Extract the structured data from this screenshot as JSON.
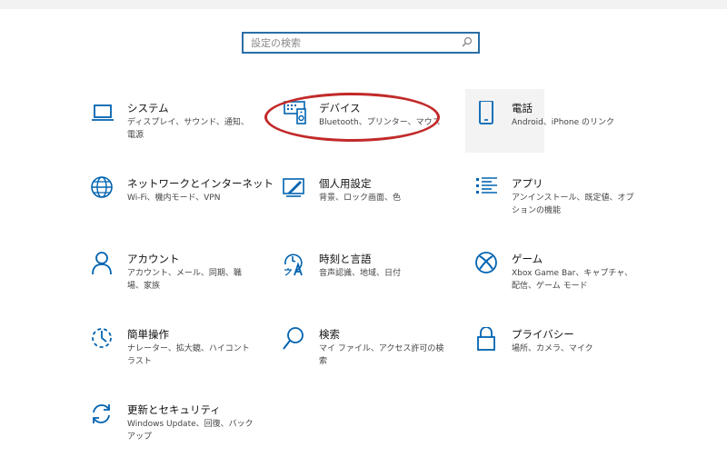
{
  "search": {
    "placeholder": "設定の検索"
  },
  "tiles": [
    {
      "title": "システム",
      "desc": "ディスプレイ、サウンド、通知、電源",
      "icon": "laptop-icon"
    },
    {
      "title": "デバイス",
      "desc": "Bluetooth、プリンター、マウス",
      "icon": "keyboard-speaker-icon"
    },
    {
      "title": "電話",
      "desc": "Android、iPhone のリンク",
      "icon": "phone-icon"
    },
    {
      "title": "ネットワークとインターネット",
      "desc": "Wi-Fi、機内モード、VPN",
      "icon": "globe-icon"
    },
    {
      "title": "個人用設定",
      "desc": "背景、ロック画面、色",
      "icon": "paint-icon"
    },
    {
      "title": "アプリ",
      "desc": "アンインストール、既定値、オプションの機能",
      "icon": "apps-list-icon"
    },
    {
      "title": "アカウント",
      "desc": "アカウント、メール、同期、職場、家族",
      "icon": "person-icon"
    },
    {
      "title": "時刻と言語",
      "desc": "音声認識、地域、日付",
      "icon": "time-language-icon"
    },
    {
      "title": "ゲーム",
      "desc": "Xbox Game Bar、キャプチャ、配信、ゲーム モード",
      "icon": "xbox-icon"
    },
    {
      "title": "簡単操作",
      "desc": "ナレーター、拡大鏡、ハイコントラスト",
      "icon": "ease-of-access-icon"
    },
    {
      "title": "検索",
      "desc": "マイ ファイル、アクセス許可の検索",
      "icon": "magnifier-icon"
    },
    {
      "title": "プライバシー",
      "desc": "場所、カメラ、マイク",
      "icon": "lock-icon"
    },
    {
      "title": "更新とセキュリティ",
      "desc": "Windows Update、回復、バックアップ",
      "icon": "refresh-icon"
    }
  ],
  "colors": {
    "accent": "#0063b1",
    "annotation": "#c22a2a",
    "search_border": "#2a6ea6"
  }
}
